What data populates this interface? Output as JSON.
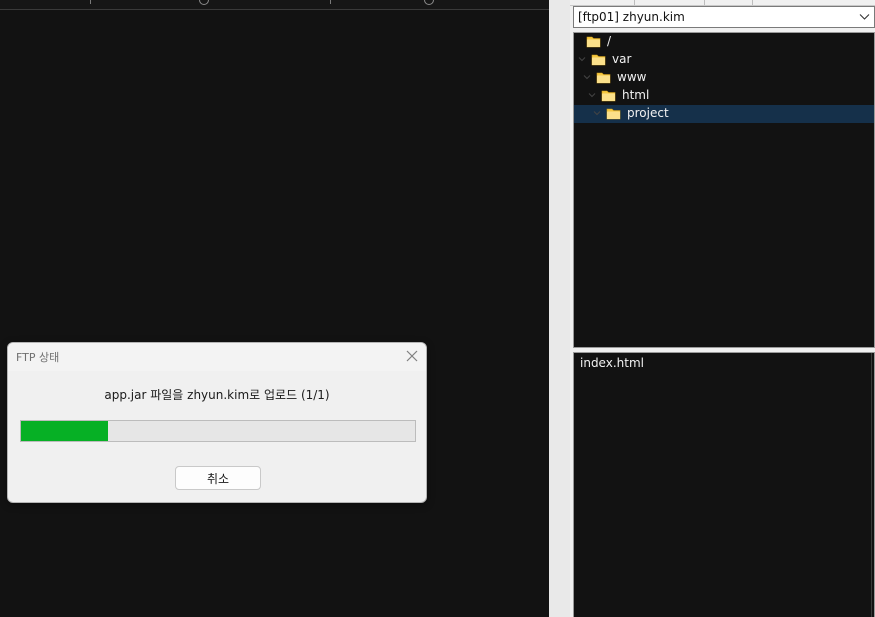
{
  "server_selector": {
    "value": "[ftp01] zhyun.kim"
  },
  "tree": {
    "nodes": [
      {
        "label": "/"
      },
      {
        "label": "var"
      },
      {
        "label": "www"
      },
      {
        "label": "html"
      },
      {
        "label": "project",
        "selected": true
      }
    ]
  },
  "file_list": {
    "items": [
      "index.html"
    ]
  },
  "dialog": {
    "title": "FTP 상태",
    "message": "app.jar 파일을 zhyun.kim로 업로드 (1/1)",
    "progress": 0.22,
    "cancel_label": "취소"
  },
  "colors": {
    "progress_fill": "#06b025",
    "selection": "#15304a",
    "folder": "#f5c842"
  },
  "icons": [
    "folder-icon",
    "chevron-down-icon",
    "close-icon",
    "expander-icon"
  ]
}
